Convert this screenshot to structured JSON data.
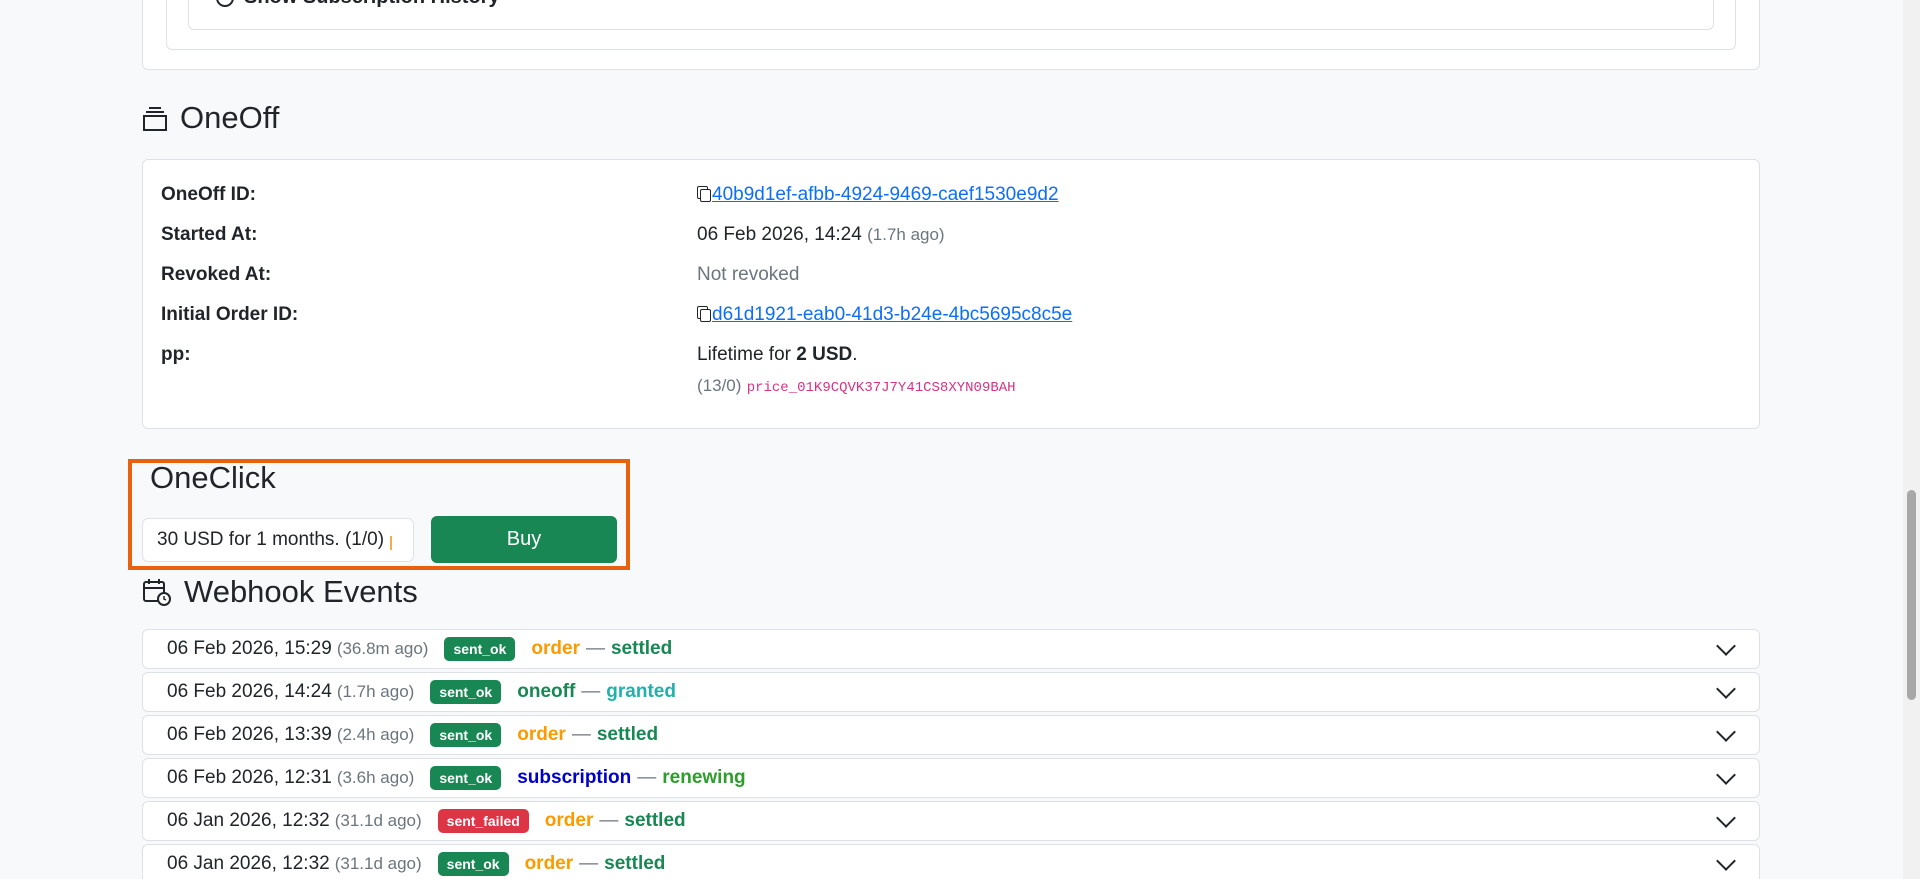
{
  "subscription": {
    "history_toggle_label": "Show Subscription History"
  },
  "oneoff": {
    "title": "OneOff",
    "rows": {
      "id": {
        "label": "OneOff ID:",
        "value": "40b9d1ef-afbb-4924-9469-caef1530e9d2"
      },
      "started": {
        "label": "Started At:",
        "value": "06 Feb 2026, 14:24",
        "ago": "(1.7h ago)"
      },
      "revoked": {
        "label": "Revoked At:",
        "value": "Not revoked"
      },
      "initial_order": {
        "label": "Initial Order ID:",
        "value": "d61d1921-eab0-41d3-b24e-4bc5695c8c5e"
      },
      "pp": {
        "label": "pp:",
        "value_prefix": "Lifetime for ",
        "value_strong": "2 USD",
        "value_suffix": ".",
        "counts": "(13/0)",
        "price_id": "price_01K9CQVK37J7Y41CS8XYN09BAH"
      }
    }
  },
  "oneclick": {
    "title": "OneClick",
    "selected_option": "30 USD for 1 months. (1/0)",
    "buy_label": "Buy"
  },
  "webhooks": {
    "title": "Webhook Events",
    "events": [
      {
        "date": "06 Feb 2026, 15:29",
        "ago": "(36.8m ago)",
        "badge": "sent_ok",
        "type": "order",
        "sep": "—",
        "status": "settled",
        "type_color": "#fd9a00",
        "status_color": "#198754"
      },
      {
        "date": "06 Feb 2026, 14:24",
        "ago": "(1.7h ago)",
        "badge": "sent_ok",
        "type": "oneoff",
        "sep": "—",
        "status": "granted",
        "type_color": "#198754",
        "status_color": "#20b2aa"
      },
      {
        "date": "06 Feb 2026, 13:39",
        "ago": "(2.4h ago)",
        "badge": "sent_ok",
        "type": "order",
        "sep": "—",
        "status": "settled",
        "type_color": "#fd9a00",
        "status_color": "#198754"
      },
      {
        "date": "06 Feb 2026, 12:31",
        "ago": "(3.6h ago)",
        "badge": "sent_ok",
        "type": "subscription",
        "sep": "—",
        "status": "renewing",
        "type_color": "#0000cc",
        "status_color": "#2e9d2e"
      },
      {
        "date": "06 Jan 2026, 12:32",
        "ago": "(31.1d ago)",
        "badge": "sent_failed",
        "type": "order",
        "sep": "—",
        "status": "settled",
        "type_color": "#fd9a00",
        "status_color": "#198754"
      },
      {
        "date": "06 Jan 2026, 12:32",
        "ago": "(31.1d ago)",
        "badge": "sent_ok",
        "type": "order",
        "sep": "—",
        "status": "settled",
        "type_color": "#fd9a00",
        "status_color": "#198754"
      }
    ]
  }
}
